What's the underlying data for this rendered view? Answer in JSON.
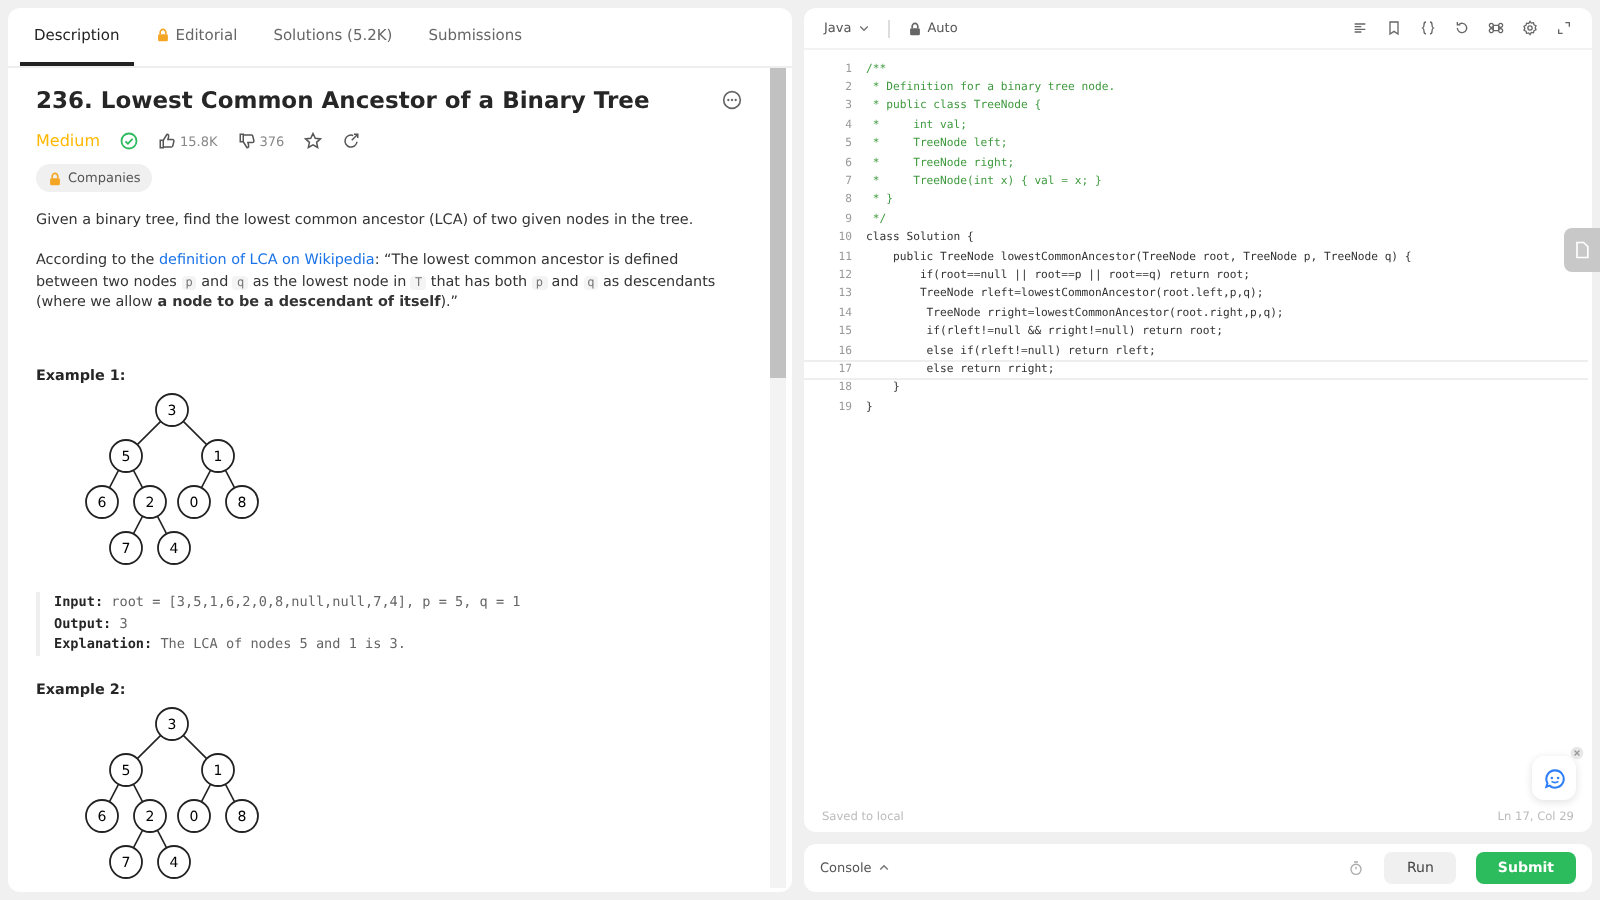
{
  "left_tabs": [
    {
      "label": "Description",
      "selected": true,
      "locked": false
    },
    {
      "label": "Editorial",
      "selected": false,
      "locked": true
    },
    {
      "label": "Solutions (5.2K)",
      "selected": false,
      "locked": false
    },
    {
      "label": "Submissions",
      "selected": false,
      "locked": false
    }
  ],
  "problem": {
    "title": "236. Lowest Common Ancestor of a Binary Tree",
    "difficulty": "Medium",
    "solved": true,
    "likes": "15.8K",
    "dislikes": "376",
    "companies": "Companies",
    "intro": "Given a binary tree, find the lowest common ancestor (LCA) of two given nodes in the tree.",
    "definition": [
      {
        "kind": "text",
        "text": "According to the "
      },
      {
        "kind": "link",
        "text": "definition of LCA on Wikipedia"
      },
      {
        "kind": "text",
        "text": ": “The lowest common ancestor is defined between two nodes "
      },
      {
        "kind": "code",
        "text": "p"
      },
      {
        "kind": "text",
        "text": " and "
      },
      {
        "kind": "code",
        "text": "q"
      },
      {
        "kind": "text",
        "text": " as the lowest node in "
      },
      {
        "kind": "code",
        "text": "T"
      },
      {
        "kind": "text",
        "text": " that has both "
      },
      {
        "kind": "code",
        "text": "p"
      },
      {
        "kind": "text",
        "text": " and "
      },
      {
        "kind": "code",
        "text": "q"
      },
      {
        "kind": "text",
        "text": " as descendants (where we allow "
      },
      {
        "kind": "bold",
        "text": "a node to be a descendant of itself"
      },
      {
        "kind": "text",
        "text": ").”"
      }
    ],
    "examples": [
      {
        "heading": "Example 1:",
        "tree": {
          "value": "3",
          "children": [
            {
              "value": "5",
              "children": [
                {
                  "value": "6"
                },
                {
                  "value": "2",
                  "children": [
                    {
                      "value": "7"
                    },
                    {
                      "value": "4"
                    }
                  ]
                }
              ]
            },
            {
              "value": "1",
              "children": [
                {
                  "value": "0"
                },
                {
                  "value": "8"
                }
              ]
            }
          ]
        },
        "lines": [
          {
            "label": "Input:",
            "value": "root = [3,5,1,6,2,0,8,null,null,7,4], p = 5, q = 1"
          },
          {
            "label": "Output:",
            "value": "3"
          },
          {
            "label": "Explanation:",
            "value": "The LCA of nodes 5 and 1 is 3."
          }
        ]
      },
      {
        "heading": "Example 2:",
        "tree": {
          "value": "3",
          "children": [
            {
              "value": "5",
              "children": [
                {
                  "value": "6"
                },
                {
                  "value": "2",
                  "children": [
                    {
                      "value": "7"
                    },
                    {
                      "value": "4"
                    }
                  ]
                }
              ]
            },
            {
              "value": "1",
              "children": [
                {
                  "value": "0"
                },
                {
                  "value": "8"
                }
              ]
            }
          ]
        }
      }
    ]
  },
  "editor": {
    "language": "Java",
    "mode": "Auto",
    "lines": [
      {
        "n": "1",
        "kind": "comment",
        "current": false,
        "text": "/**"
      },
      {
        "n": "2",
        "kind": "comment",
        "current": false,
        "text": " * Definition for a binary tree node."
      },
      {
        "n": "3",
        "kind": "comment",
        "current": false,
        "text": " * public class TreeNode {"
      },
      {
        "n": "4",
        "kind": "comment",
        "current": false,
        "text": " *     int val;"
      },
      {
        "n": "5",
        "kind": "comment",
        "current": false,
        "text": " *     TreeNode left;"
      },
      {
        "n": "6",
        "kind": "comment",
        "current": false,
        "text": " *     TreeNode right;"
      },
      {
        "n": "7",
        "kind": "comment",
        "current": false,
        "text": " *     TreeNode(int x) { val = x; }"
      },
      {
        "n": "8",
        "kind": "comment",
        "current": false,
        "text": " * }"
      },
      {
        "n": "9",
        "kind": "comment",
        "current": false,
        "text": " */"
      },
      {
        "n": "10",
        "kind": "code",
        "current": false,
        "text": "class Solution {"
      },
      {
        "n": "11",
        "kind": "code",
        "current": false,
        "text": "    public TreeNode lowestCommonAncestor(TreeNode root, TreeNode p, TreeNode q) {"
      },
      {
        "n": "12",
        "kind": "code",
        "current": false,
        "text": "        if(root==null || root==p || root==q) return root;"
      },
      {
        "n": "13",
        "kind": "code",
        "current": false,
        "text": "        TreeNode rleft=lowestCommonAncestor(root.left,p,q);"
      },
      {
        "n": "14",
        "kind": "code",
        "current": false,
        "text": "         TreeNode rright=lowestCommonAncestor(root.right,p,q);"
      },
      {
        "n": "15",
        "kind": "code",
        "current": false,
        "text": "         if(rleft!=null && rright!=null) return root;"
      },
      {
        "n": "16",
        "kind": "code",
        "current": false,
        "text": "         else if(rleft!=null) return rleft;"
      },
      {
        "n": "17",
        "kind": "code",
        "current": true,
        "text": "         else return rright;"
      },
      {
        "n": "18",
        "kind": "code",
        "current": false,
        "text": "    }"
      },
      {
        "n": "19",
        "kind": "code",
        "current": false,
        "text": "}"
      }
    ],
    "saved": "Saved to local",
    "cursor": "Ln 17, Col 29"
  },
  "bottom": {
    "console": "Console",
    "run": "Run",
    "submit": "Submit"
  }
}
